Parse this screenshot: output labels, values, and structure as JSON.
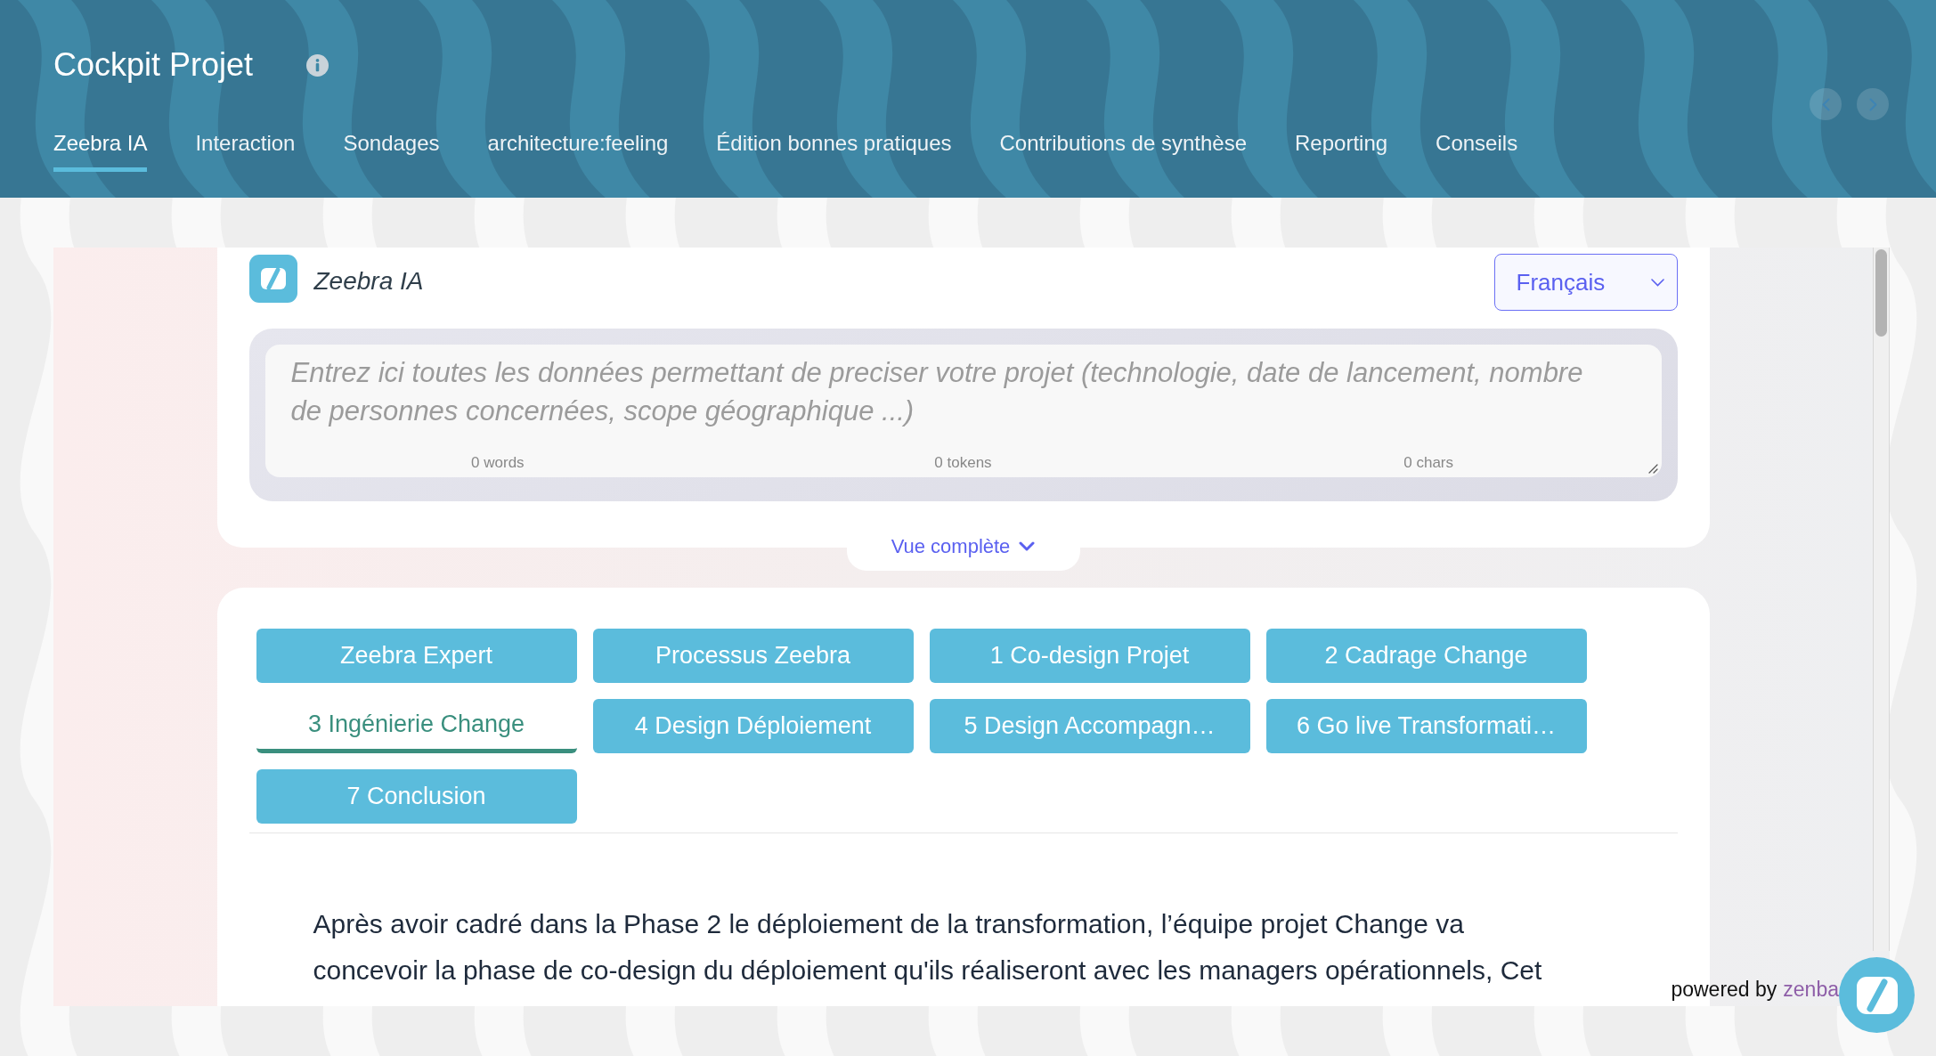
{
  "header": {
    "title": "Cockpit Projet",
    "tabs": [
      {
        "label": "Zeebra IA",
        "selected": true
      },
      {
        "label": "Interaction",
        "selected": false
      },
      {
        "label": "Sondages",
        "selected": false
      },
      {
        "label": "architecture:feeling",
        "selected": false
      },
      {
        "label": "Édition bonnes pratiques",
        "selected": false
      },
      {
        "label": "Contributions de synthèse",
        "selected": false
      },
      {
        "label": "Reporting",
        "selected": false
      },
      {
        "label": "Conseils",
        "selected": false
      }
    ]
  },
  "assistant": {
    "name": "Zeebra IA",
    "language": "Français",
    "prompt": {
      "placeholder": "Entrez ici toutes les données permettant de preciser votre projet (technologie, date de lancement, nombre de personnes concernées, scope géographique ...)",
      "counters": [
        "0 words",
        "0 tokens",
        "0 chars"
      ]
    },
    "expand_label": "Vue complète"
  },
  "phases": [
    {
      "label": "Zeebra Expert",
      "selected": false
    },
    {
      "label": "Processus Zeebra",
      "selected": false
    },
    {
      "label": "1 Co-design Projet",
      "selected": false
    },
    {
      "label": "2 Cadrage Change",
      "selected": false
    },
    {
      "label": "3 Ingénierie Change",
      "selected": true
    },
    {
      "label": "4 Design Déploiement",
      "selected": false
    },
    {
      "label": "5 Design Accompagn…",
      "selected": false
    },
    {
      "label": "6 Go live Transformati…",
      "selected": false
    },
    {
      "label": "7 Conclusion",
      "selected": false
    }
  ],
  "content": {
    "paragraph_lines": [
      "Après avoir cadré dans la Phase 2 le déploiement de la transformation, l’équipe projet Change va",
      "concevoir la phase de co-design du déploiement qu'ils réaliseront avec les managers opérationnels, Cet"
    ]
  },
  "footer": {
    "powered_by": "powered by",
    "brand": "zenba"
  }
}
